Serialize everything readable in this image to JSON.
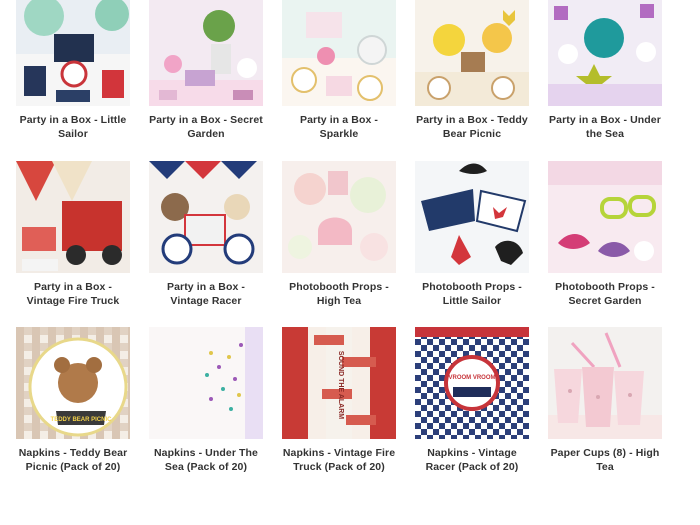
{
  "products": [
    {
      "title": "Party in a Box - Little Sailor"
    },
    {
      "title": "Party in a Box - Secret Garden"
    },
    {
      "title": "Party in a Box - Sparkle"
    },
    {
      "title": "Party in a Box - Teddy Bear Picnic"
    },
    {
      "title": "Party in a Box - Under the Sea"
    },
    {
      "title": "Party in a Box - Vintage Fire Truck"
    },
    {
      "title": "Party in a Box - Vintage Racer"
    },
    {
      "title": "Photobooth Props - High Tea"
    },
    {
      "title": "Photobooth Props - Little Sailor"
    },
    {
      "title": "Photobooth Props - Secret Garden"
    },
    {
      "title": "Napkins - Teddy Bear Picnic (Pack of 20)",
      "image_text": "TEDDY BEAR PICNIC"
    },
    {
      "title": "Napkins - Under The Sea (Pack of 20)"
    },
    {
      "title": "Napkins - Vintage Fire Truck (Pack of 20)",
      "image_text": "SOUND THE ALARM"
    },
    {
      "title": "Napkins - Vintage Racer (Pack of 20)",
      "image_text": "VROOM VROOM"
    },
    {
      "title": "Paper Cups (8) - High Tea"
    }
  ]
}
